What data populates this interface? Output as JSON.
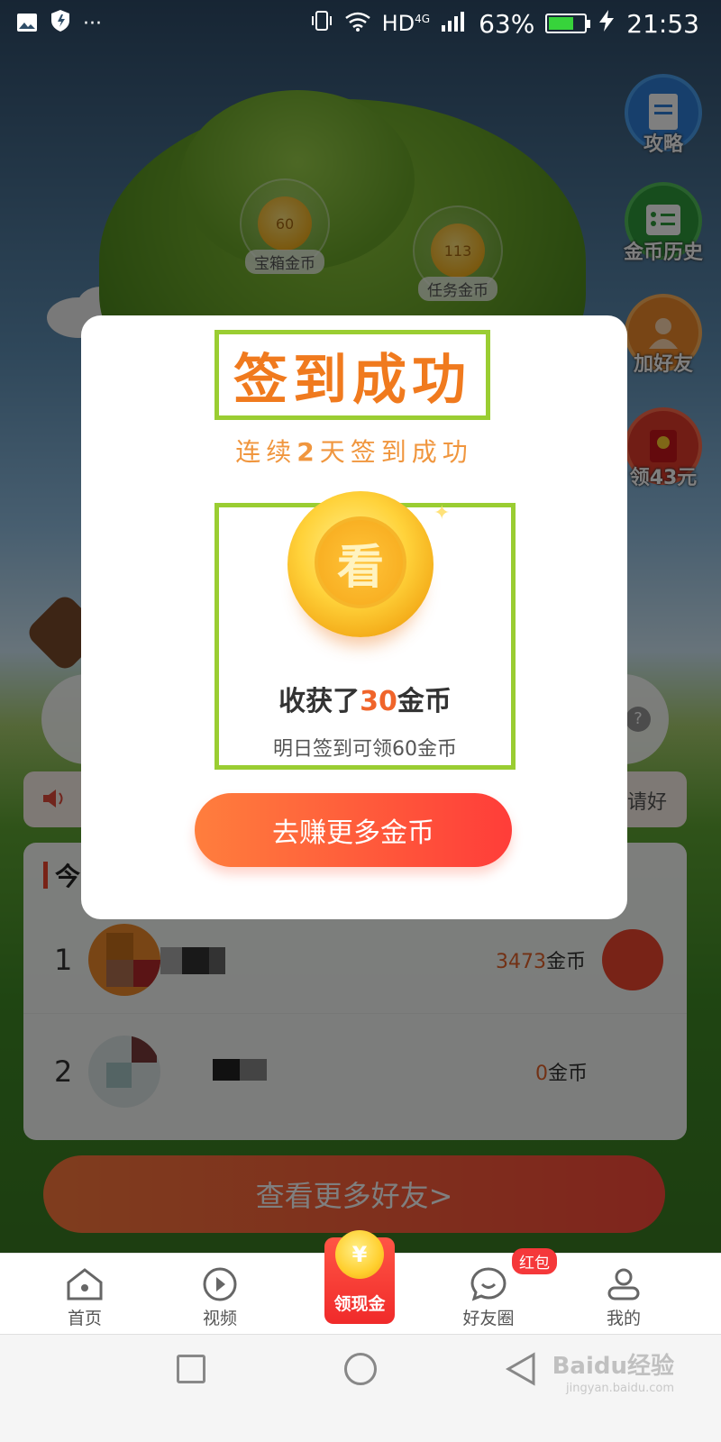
{
  "status_bar": {
    "network": "HD",
    "network_sup": "4G",
    "battery": "63%",
    "time": "21:53"
  },
  "scene": {
    "chest_coins_value": "60",
    "chest_coins_label": "宝箱金币",
    "task_coins_value": "113",
    "task_coins_label": "任务金币",
    "side_buttons": [
      {
        "label": "攻略",
        "icon": "document-icon",
        "color": "#2f7fd8"
      },
      {
        "label": "金币历史",
        "icon": "checklist-icon",
        "color": "#2f9a3b"
      },
      {
        "label": "加好友",
        "icon": "add-friend-icon",
        "color": "#f08a2a"
      },
      {
        "label": "领43元",
        "icon": "red-envelope-icon",
        "color": "#e33a2a"
      }
    ],
    "notice_partial_text": "邀请好",
    "list_title_partial": "今",
    "ranking": [
      {
        "rank": "1",
        "coins_value": "3473",
        "coins_unit": "金币"
      },
      {
        "rank": "2",
        "coins_value": "0",
        "coins_unit": "金币"
      }
    ],
    "more_friends_label": "查看更多好友>"
  },
  "modal": {
    "title": "签到成功",
    "subtitle_prefix": "连续",
    "subtitle_days": "2",
    "subtitle_suffix": "天签到成功",
    "coin_glyph": "看",
    "gain_prefix": "收获了",
    "gain_value": "30",
    "gain_unit": "金币",
    "tomorrow_text": "明日签到可领60金币",
    "earn_button": "去赚更多金币"
  },
  "bottom_nav": {
    "items": [
      {
        "label": "首页",
        "icon": "home-icon"
      },
      {
        "label": "视频",
        "icon": "play-icon"
      },
      {
        "label": "领现金",
        "icon": "yuan-coin-icon"
      },
      {
        "label": "好友圈",
        "icon": "chat-bubble-icon"
      },
      {
        "label": "我的",
        "icon": "profile-icon"
      }
    ],
    "cash_coin_glyph": "¥",
    "friend_badge": "红包"
  },
  "watermark": {
    "brand": "Baidu经验",
    "url": "jingyan.baidu.com"
  }
}
